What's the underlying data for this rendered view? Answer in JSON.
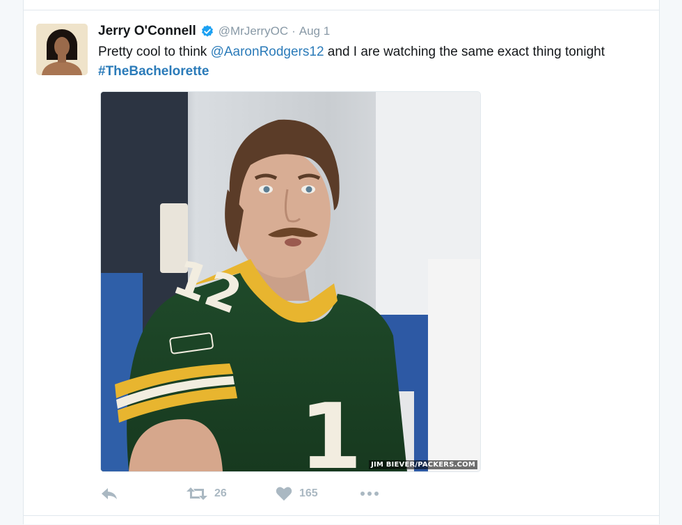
{
  "tweet": {
    "fullname": "Jerry O'Connell",
    "handle": "@MrJerryOC",
    "separator": "·",
    "timestamp": "Aug 1",
    "text_part1": "Pretty cool to think ",
    "mention": "@AaronRodgers12",
    "text_part2": " and I are watching the same exact thing tonight ",
    "hashtag": "#TheBachelorette",
    "media_credit": "JIM BIEVER/PACKERS.COM"
  },
  "actions": {
    "retweet_count": "26",
    "like_count": "165"
  },
  "colors": {
    "link": "#2b7bb9",
    "verified": "#1da1f2",
    "muted": "#8899a6",
    "action_icon": "#aab8c2"
  },
  "icons": {
    "verified": "verified-badge-icon",
    "reply": "reply-arrow-icon",
    "retweet": "retweet-icon",
    "like": "heart-icon",
    "more": "ellipsis-icon"
  }
}
